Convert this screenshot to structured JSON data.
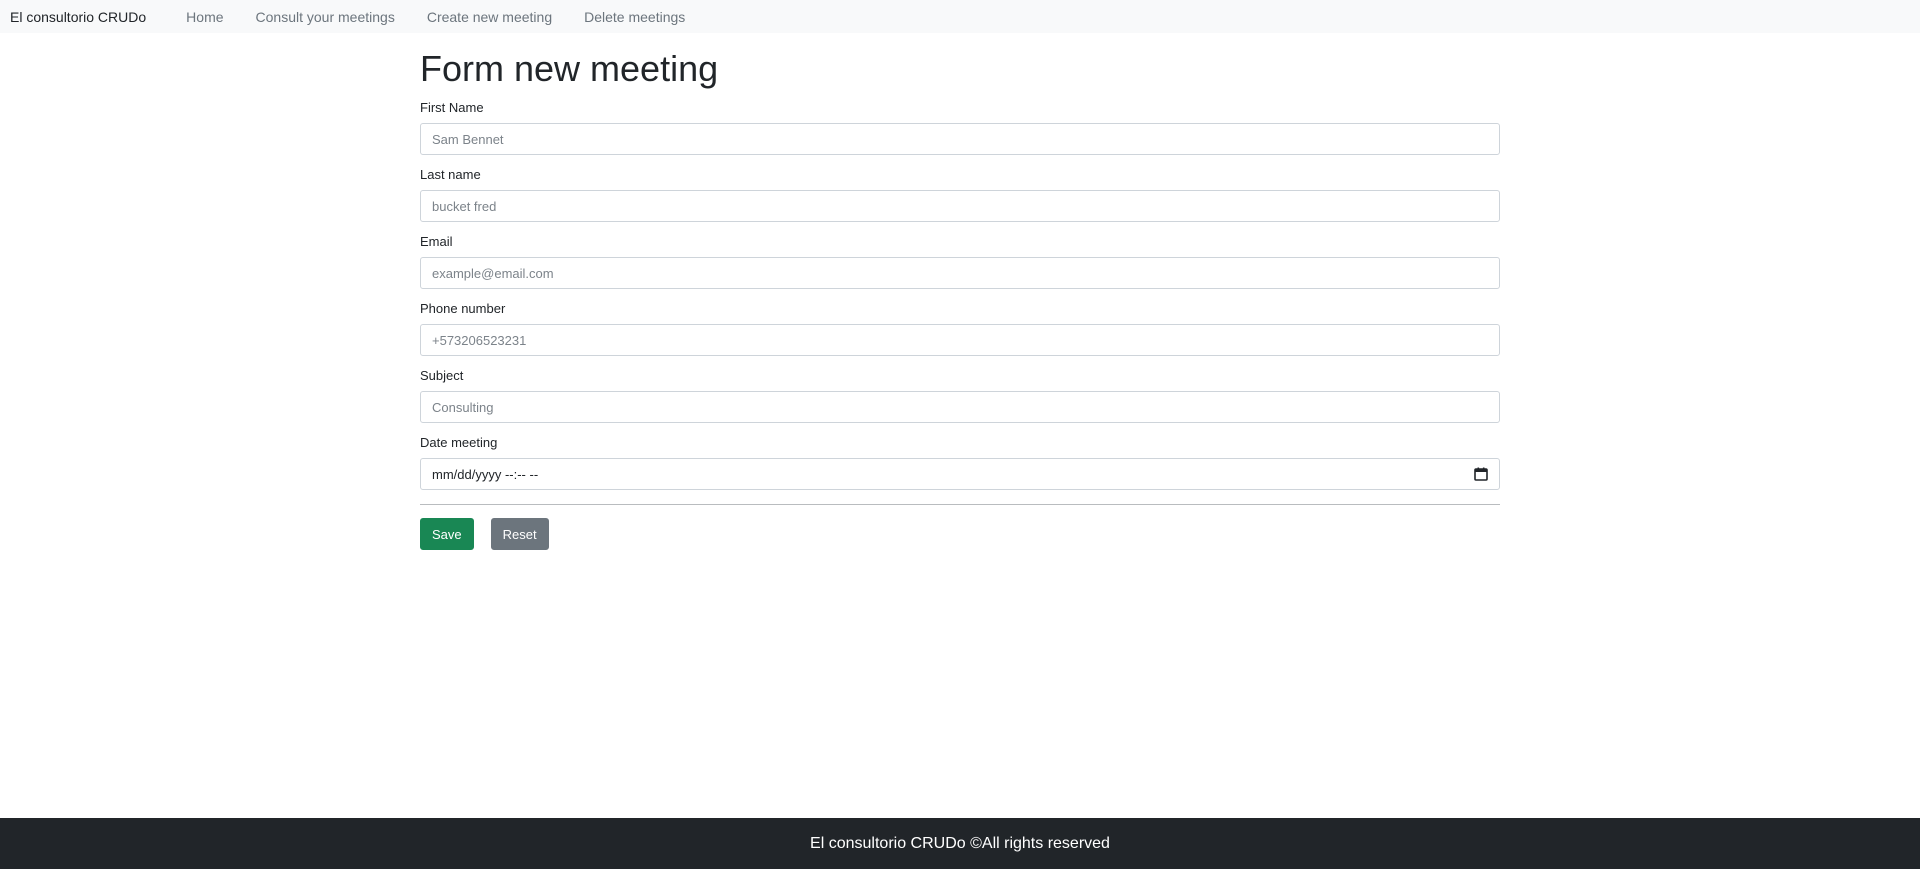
{
  "nav": {
    "brand": "El consultorio CRUDo",
    "links": [
      "Home",
      "Consult your meetings",
      "Create new meeting",
      "Delete meetings"
    ]
  },
  "main": {
    "title": "Form new meeting",
    "fields": {
      "first_name": {
        "label": "First Name",
        "placeholder": "Sam Bennet",
        "value": ""
      },
      "last_name": {
        "label": "Last name",
        "placeholder": "bucket fred",
        "value": ""
      },
      "email": {
        "label": "Email",
        "placeholder": "example@email.com",
        "value": ""
      },
      "phone": {
        "label": "Phone number",
        "placeholder": "+573206523231",
        "value": ""
      },
      "subject": {
        "label": "Subject",
        "placeholder": "Consulting",
        "value": ""
      },
      "date": {
        "label": "Date meeting",
        "display": "mm/dd/yyyy --:-- --",
        "icon": "calendar-icon"
      }
    },
    "buttons": {
      "save": "Save",
      "reset": "Reset"
    },
    "colors": {
      "save": "#198754",
      "reset": "#6c757d"
    }
  },
  "footer": {
    "text": "El consultorio CRUDo ©All rights reserved"
  }
}
